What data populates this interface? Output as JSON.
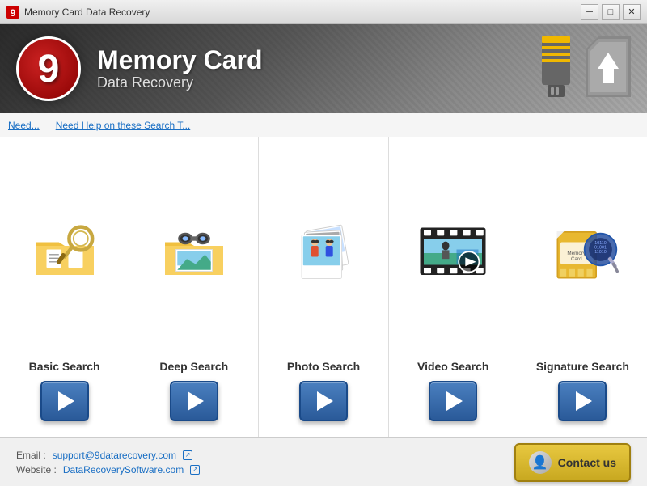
{
  "window": {
    "title": "Memory Card Data Recovery",
    "min_btn": "─",
    "max_btn": "□",
    "close_btn": "✕"
  },
  "header": {
    "logo_text": "9",
    "title": "Memory Card",
    "subtitle": "Data Recovery"
  },
  "nav": {
    "link1": "Need...",
    "link2": "Need Help on these Search T..."
  },
  "search_options": [
    {
      "id": "basic",
      "label": "Basic Search",
      "icon": "magnify-folder-icon"
    },
    {
      "id": "deep",
      "label": "Deep Search",
      "icon": "binoculars-folder-icon"
    },
    {
      "id": "photo",
      "label": "Photo Search",
      "icon": "photos-icon"
    },
    {
      "id": "video",
      "label": "Video Search",
      "icon": "video-film-icon"
    },
    {
      "id": "signature",
      "label": "Signature Search",
      "icon": "signature-memcard-icon"
    }
  ],
  "footer": {
    "email_label": "Email :",
    "email_value": "support@9datarecovery.com",
    "website_label": "Website :",
    "website_value": "DataRecoverySoftware.com",
    "contact_btn": "Contact us"
  }
}
